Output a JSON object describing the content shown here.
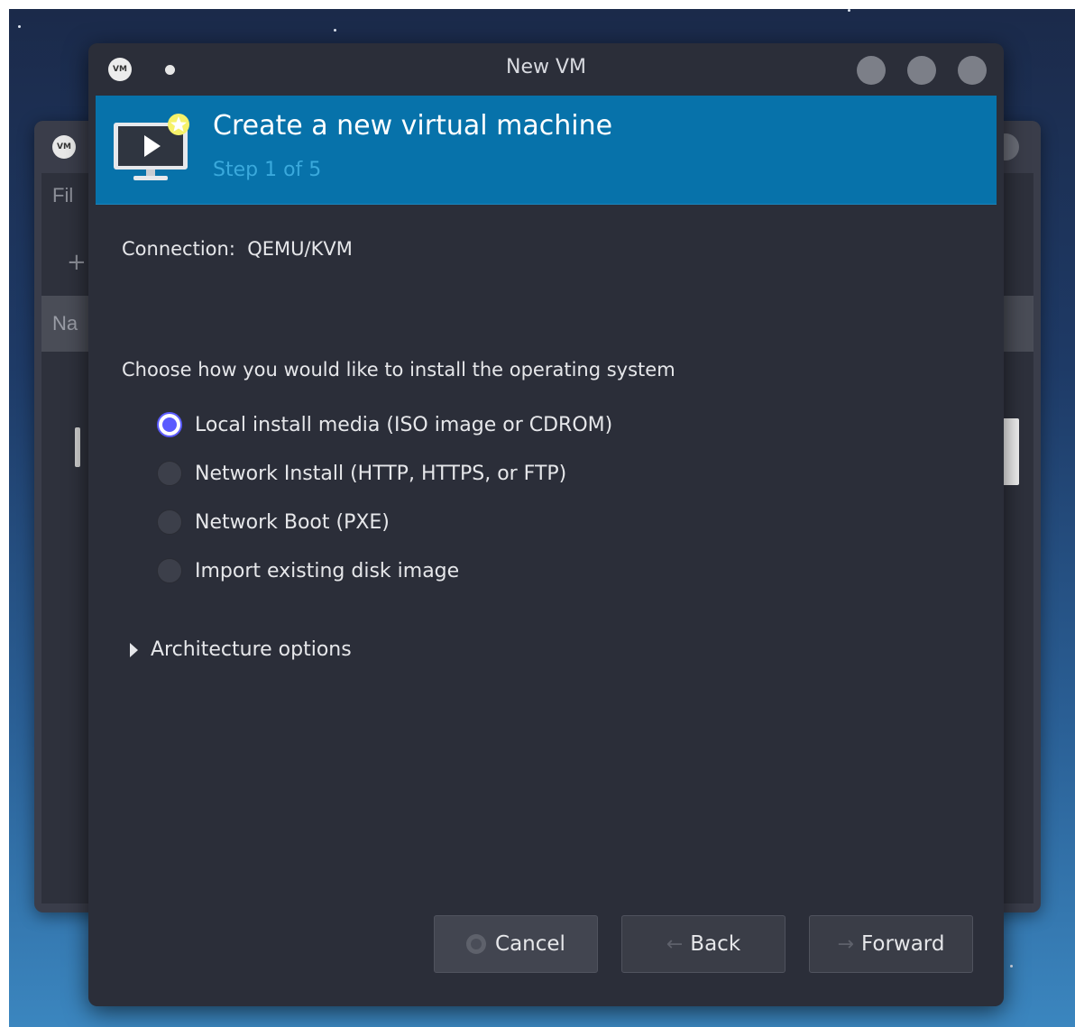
{
  "background_window": {
    "menu_label": "Fil",
    "header_label": "Na"
  },
  "dialog": {
    "title": "New VM",
    "app_logo_text": "VM"
  },
  "banner": {
    "title": "Create a new virtual machine",
    "step": "Step 1 of 5"
  },
  "connection": {
    "text": "Connection:  QEMU/KVM"
  },
  "install": {
    "prompt": "Choose how you would like to install the operating system",
    "options": [
      {
        "label": "Local install media (ISO image or CDROM)",
        "selected": true
      },
      {
        "label": "Network Install (HTTP, HTTPS, or FTP)",
        "selected": false
      },
      {
        "label": "Network Boot (PXE)",
        "selected": false
      },
      {
        "label": "Import existing disk image",
        "selected": false
      }
    ]
  },
  "architecture": {
    "label": "Architecture options",
    "expanded": false
  },
  "footer": {
    "cancel_label": "Cancel",
    "back_label": "Back",
    "forward_label": "Forward"
  },
  "icons": {
    "app": "virt-manager-logo-icon",
    "banner": "monitor-play-new-icon",
    "cancel": "cancel-icon",
    "back": "arrow-left-icon",
    "forward": "arrow-right-icon",
    "expander": "triangle-right-icon"
  },
  "colors": {
    "banner_bg": "#0772aa",
    "radio_accent": "#5b5bff",
    "dialog_bg": "#2b2e39"
  }
}
